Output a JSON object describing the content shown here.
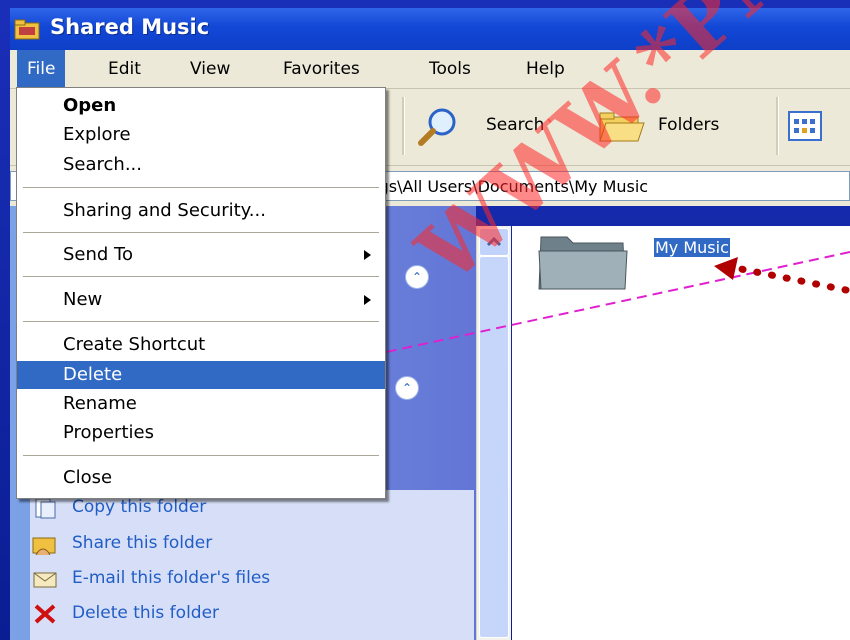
{
  "window": {
    "title": "Shared Music"
  },
  "menubar": {
    "items": [
      "File",
      "Edit",
      "View",
      "Favorites",
      "Tools",
      "Help"
    ]
  },
  "toolbar": {
    "search_label": "Search",
    "folders_label": "Folders"
  },
  "address": {
    "path": "C:\\Documents and Settings\\All Users\\Documents\\My Music"
  },
  "file_menu": {
    "open": "Open",
    "explore": "Explore",
    "search": "Search...",
    "sharing": "Sharing and Security...",
    "send_to": "Send To",
    "new": "New",
    "create_shortcut": "Create Shortcut",
    "delete": "Delete",
    "rename": "Rename",
    "properties": "Properties",
    "close": "Close"
  },
  "tasks": {
    "copy": "Copy this folder",
    "share": "Share this folder",
    "email": "E-mail this folder's files",
    "delete": "Delete this folder"
  },
  "folder": {
    "name": "My Music"
  },
  "watermark": "WWW.*PN",
  "colors": {
    "titlebar": "#1247d6",
    "selection": "#316ac5",
    "link": "#215dc6",
    "arrow": "#e020d0",
    "dots": "#c00000"
  }
}
